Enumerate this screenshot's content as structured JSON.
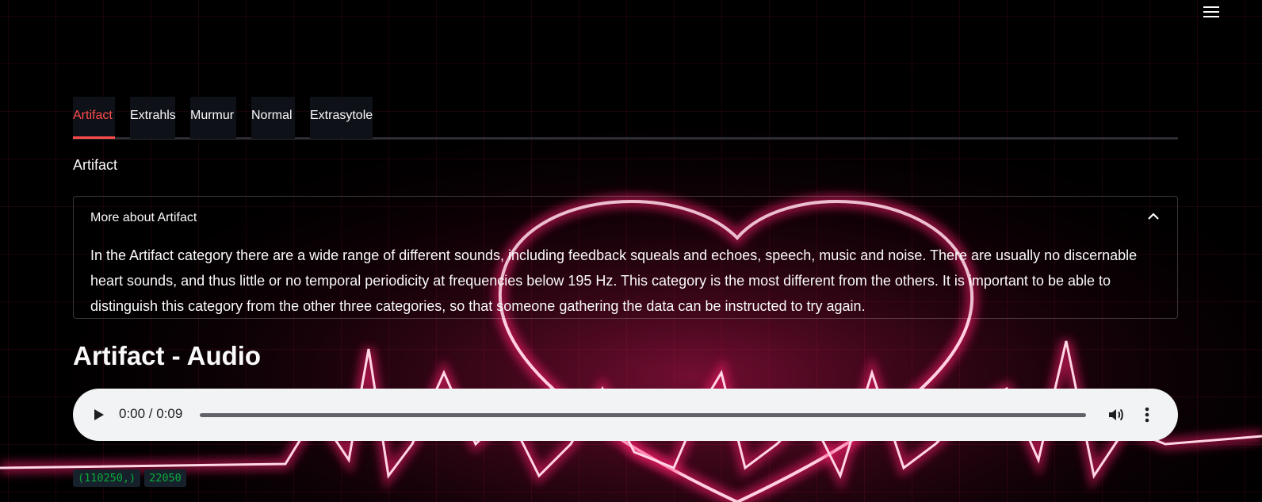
{
  "tabs": [
    {
      "label": "Artifact",
      "active": true
    },
    {
      "label": "Extrahls",
      "active": false
    },
    {
      "label": "Murmur",
      "active": false
    },
    {
      "label": "Normal",
      "active": false
    },
    {
      "label": "Extrasytole",
      "active": false
    }
  ],
  "section_label": "Artifact",
  "expander": {
    "title": "More about Artifact",
    "body": "In the Artifact category there are a wide range of different sounds, including feedback squeals and echoes, speech, music and noise. There are usually no discernable heart sounds, and thus little or no temporal periodicity at frequencies below 195 Hz. This category is the most different from the others. It is important to be able to distinguish this category from the other three categories, so that someone gathering the data can be instructed to try again.",
    "icon": "chevron-up-icon"
  },
  "audio": {
    "title": "Artifact - Audio",
    "time": "0:00 / 0:09",
    "progress": 0
  },
  "outputs": [
    "(110250,)",
    "22050"
  ],
  "colors": {
    "accent": "#ff4b4b",
    "neon": "#ff1e6e",
    "code_text": "#09ab3b",
    "code_bg": "#17212b"
  },
  "icons": [
    "hamburger-menu-icon",
    "chevron-up-icon",
    "play-icon",
    "volume-icon",
    "more-vert-icon"
  ]
}
